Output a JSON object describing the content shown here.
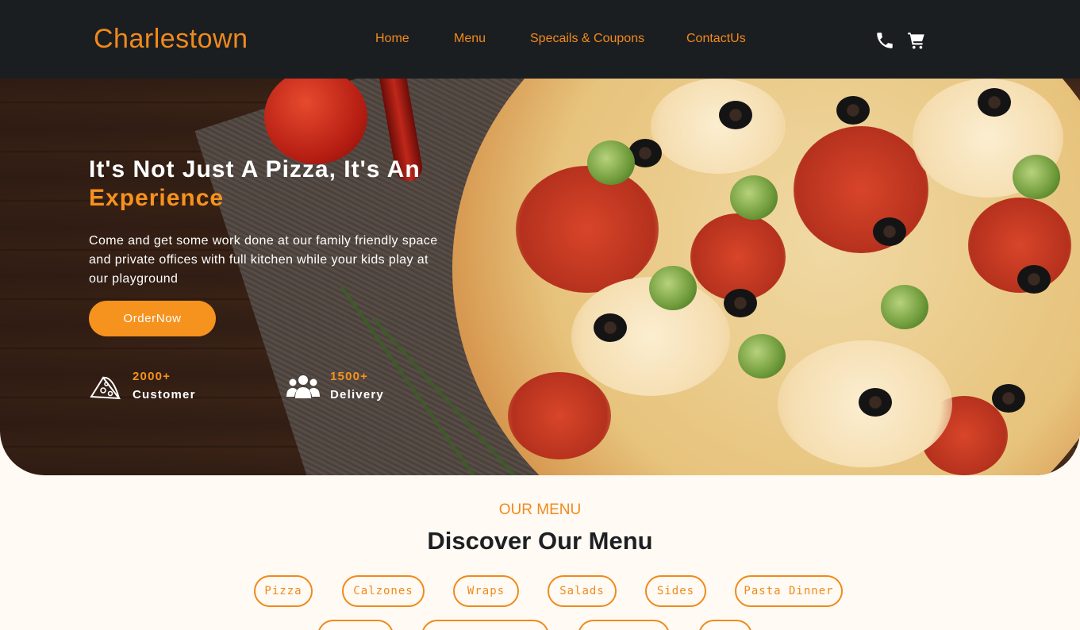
{
  "navbar": {
    "logo": "Charlestown",
    "links": [
      {
        "label": "Home"
      },
      {
        "label": "Menu"
      },
      {
        "label": "Specails & Coupons"
      },
      {
        "label": "ContactUs"
      }
    ],
    "icons": [
      "phone-icon",
      "cart-icon"
    ]
  },
  "hero": {
    "title_part1": "It's Not Just A Pizza, It's An ",
    "title_accent": "Experience",
    "description": "Come and get some work done at our family friendly space and private offices with full kitchen while your kids play at our playground",
    "order_button": "OrderNow",
    "stats": [
      {
        "icon": "pizza-slice-icon",
        "number": "2000+",
        "label": "Customer"
      },
      {
        "icon": "users-icon",
        "number": "1500+",
        "label": "Delivery"
      }
    ]
  },
  "menu": {
    "eyebrow": "OUR MENU",
    "title": "Discover Our Menu",
    "categories": [
      "Pizza",
      "Calzones",
      "Wraps",
      "Salads",
      "Sides",
      "Pasta Dinner"
    ]
  },
  "colors": {
    "accent": "#f08a1c",
    "navbar_bg": "#1b1e21",
    "section_bg": "#fffaf3"
  }
}
